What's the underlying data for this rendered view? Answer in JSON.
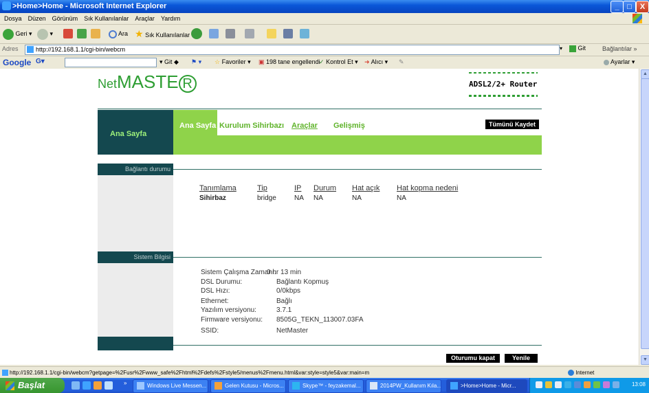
{
  "window": {
    "title": ">Home>Home - Microsoft Internet Explorer",
    "min_label": "_",
    "max_label": "□",
    "close_label": "X"
  },
  "menu": [
    "Dosya",
    "Düzen",
    "Görünüm",
    "Sık Kullanılanlar",
    "Araçlar",
    "Yardım"
  ],
  "toolbar": {
    "back_label": "Geri",
    "search_label": "Ara",
    "favorites_label": "Sık Kullanılanlar"
  },
  "address": {
    "label": "Adres",
    "url": "http://192.168.1.1/cgi-bin/webcm",
    "go_label": "Git",
    "links_label": "Bağlantılar"
  },
  "google_bar": {
    "logo": "Google",
    "go_label": "Git",
    "favorites_label": "Favoriler",
    "blocked_label": "198 tane engellendi",
    "check_label": "Kontrol Et",
    "send_label": "Alıcı",
    "settings_label": "Ayarlar"
  },
  "router": {
    "logo_net": "Net",
    "logo_master": "MASTE",
    "logo_r": "R",
    "model": "ADSL2/2+ Router",
    "left_nav": "Ana Sayfa",
    "tabs": [
      {
        "label": "Ana Sayfa"
      },
      {
        "label": "Kurulum Sihirbazı"
      },
      {
        "label": "Araçlar"
      },
      {
        "label": "Gelişmiş"
      }
    ],
    "save_all": "Tümünü Kaydet",
    "section_connection": "Bağlantı durumu",
    "section_system": "Sistem Bilgisi",
    "table_headers": [
      "Tanımlama",
      "Tip",
      "IP",
      "Durum",
      "Hat açık",
      "Hat kopma nedeni"
    ],
    "table_row": [
      "Sihirbaz",
      "bridge",
      "NA",
      "NA",
      "NA",
      "NA"
    ],
    "system_info": [
      {
        "label": "Sistem Çalışma Zamanı:",
        "value": "0 hr 13 min"
      },
      {
        "label": "DSL Durumu:",
        "value": "Bağlantı Kopmuş"
      },
      {
        "label": "DSL Hızı:",
        "value": "0/0kbps"
      },
      {
        "label": "Ethernet:",
        "value": "Bağlı"
      },
      {
        "label": "Yazılım versiyonu:",
        "value": "3.7.1"
      },
      {
        "label": "Firmware versiyonu:",
        "value": "8505G_TEKN_113007.03FA"
      },
      {
        "label": "SSID:",
        "value": "NetMaster"
      }
    ],
    "logout": "Oturumu kapat",
    "refresh": "Yenile"
  },
  "status": {
    "url": "http://192.168.1.1/cgi-bin/webcm?getpage=%2Fusr%2Fwww_safe%2Fhtml%2Fdefs%2Fstyle5/menus%2Fmenu.html&var:style=style5&var:main=m",
    "zone": "Internet"
  },
  "taskbar": {
    "start": "Başlat",
    "tasks": [
      {
        "label": "Windows Live Messen..."
      },
      {
        "label": "Gelen Kutusu - Micros..."
      },
      {
        "label": "Skype™ - feyzakemal..."
      },
      {
        "label": "2014PW_Kullanım Kıla..."
      },
      {
        "label": ">Home>Home - Micr..."
      }
    ],
    "clock": "13:08"
  }
}
